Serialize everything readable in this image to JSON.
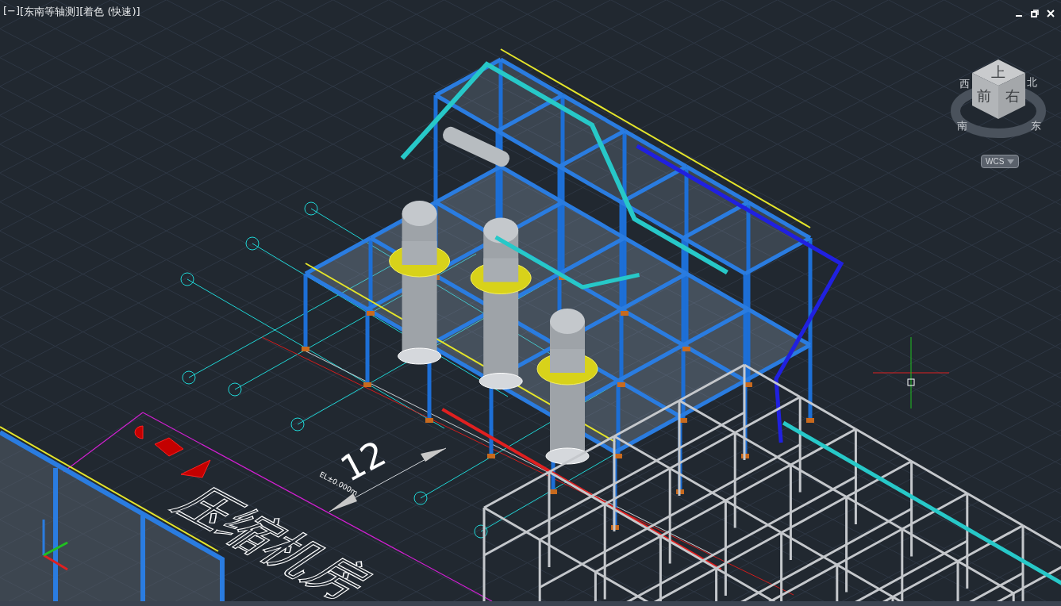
{
  "viewport": {
    "labels": [
      {
        "text": "[−]"
      },
      {
        "text": "[东南等轴测]"
      },
      {
        "text": "[着色 (快速)]"
      }
    ]
  },
  "viewcube": {
    "faces": [
      {
        "text": "上"
      },
      {
        "text": "前"
      },
      {
        "text": "右"
      }
    ],
    "compass": [
      {
        "text": "西"
      },
      {
        "text": "北"
      },
      {
        "text": "南"
      },
      {
        "text": "东"
      }
    ],
    "ucs_menu": "WCS"
  },
  "annotations": [
    {
      "kind": "number",
      "text": "12"
    },
    {
      "kind": "elevation",
      "text": "EL±0.000m"
    },
    {
      "kind": "room",
      "text": "压缩机房"
    }
  ]
}
